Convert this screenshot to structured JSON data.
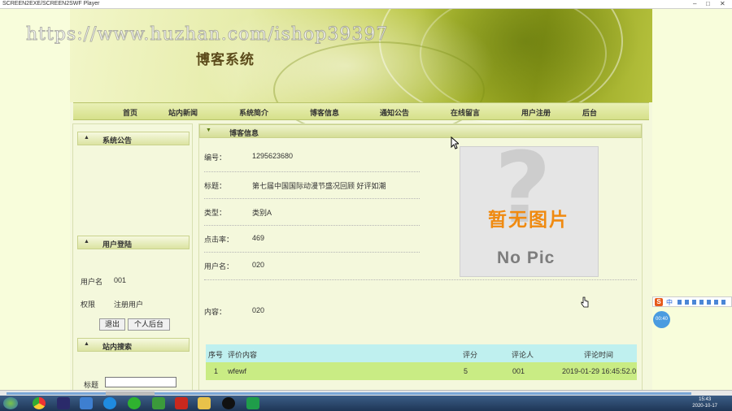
{
  "window": {
    "title": "SCREEN2EXE/SCREEN2SWF Player",
    "controls": [
      "–",
      "□",
      "✕"
    ]
  },
  "watermark": "https://www.huzhan.com/ishop39397",
  "site": {
    "name": "博客系统"
  },
  "nav": [
    "首页",
    "站内新闻",
    "系统简介",
    "博客信息",
    "通知公告",
    "在线留言",
    "用户注册",
    "后台"
  ],
  "sidebar": {
    "announcement": {
      "title": "系统公告"
    },
    "login": {
      "title": "用户登陆",
      "username_label": "用户名",
      "username_value": "001",
      "role_label": "权限",
      "role_value": "注册用户",
      "logout_button": "退出",
      "personal_button": "个人后台"
    },
    "search": {
      "title": "站内搜索",
      "title_label": "标题",
      "title_value": ""
    }
  },
  "main": {
    "header": "博客信息",
    "fields": [
      {
        "label": "编号：",
        "value": "1295623680"
      },
      {
        "label": "标题：",
        "value": "第七届中国国际动漫节盛况回顾 好评如潮"
      },
      {
        "label": "类型：",
        "value": "类别A"
      },
      {
        "label": "点击率：",
        "value": "469"
      },
      {
        "label": "用户名：",
        "value": "020"
      }
    ],
    "content": {
      "label": "内容：",
      "value": "020"
    },
    "no_picture": {
      "text_cn": "暂无图片",
      "text_en": "No Pic"
    },
    "comments": {
      "headers": {
        "index": "序号",
        "content": "评价内容",
        "score": "评分",
        "reviewer": "评论人",
        "time": "评论时间"
      },
      "rows": [
        {
          "index": "1",
          "content": "wfewf",
          "score": "5",
          "reviewer": "001",
          "time": "2019-01-29 16:45:52.0"
        }
      ]
    }
  },
  "taskbar": {
    "time": "15:43",
    "date": "2020-10-17",
    "apps": [
      "start",
      "chrome",
      "media",
      "network",
      "browser",
      "wechat",
      "spreadsheet",
      "flash",
      "folder",
      "qq",
      "player"
    ]
  },
  "ime": {
    "badge": "S",
    "mode": "中"
  },
  "floating_bubble": "00:40"
}
